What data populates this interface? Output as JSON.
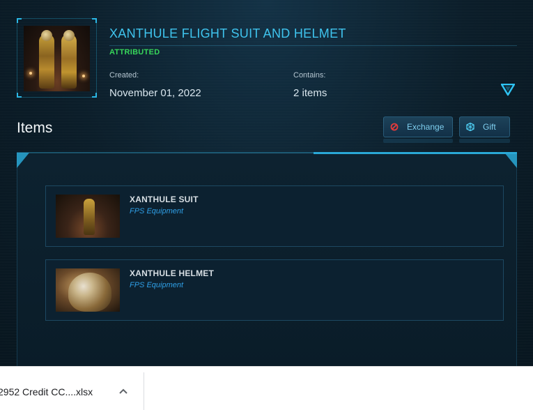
{
  "pledge": {
    "title": "XANTHULE FLIGHT SUIT AND HELMET",
    "status": "ATTRIBUTED",
    "created_label": "Created:",
    "created_value": "November 01, 2022",
    "contains_label": "Contains:",
    "contains_value": "2 items",
    "status_color": "#37d65a",
    "accent_color": "#3fc4ee"
  },
  "items_section": {
    "heading": "Items",
    "exchange_label": "Exchange",
    "gift_label": "Gift",
    "items": [
      {
        "name": "XANTHULE SUIT",
        "type": "FPS Equipment",
        "image": "suit-thumbnail"
      },
      {
        "name": "XANTHULE HELMET",
        "type": "FPS Equipment",
        "image": "helmet-thumbnail"
      }
    ]
  },
  "downloads": {
    "file_name": "2952 Credit CC....xlsx"
  },
  "icons": {
    "expand": "chevron-triangle-down-icon",
    "exchange": "exchange-icon",
    "gift": "gift-icon",
    "download_menu": "chevron-up-icon"
  }
}
